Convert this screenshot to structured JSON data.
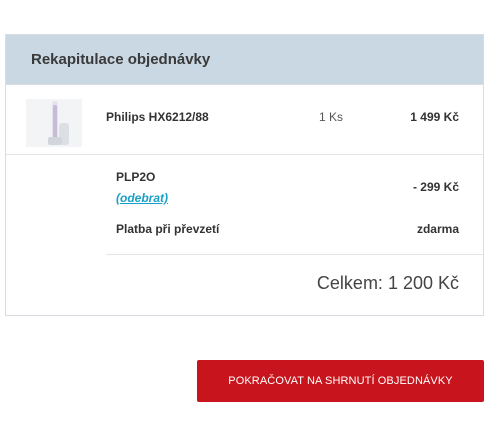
{
  "summary": {
    "title": "Rekapitulace objednávky",
    "product": {
      "name": "Philips HX6212/88",
      "quantity": "1 Ks",
      "price": "1 499 Kč",
      "thumbnail_icon": "toothbrush-icon"
    },
    "discount": {
      "code": "PLP2O",
      "remove_label": "(odebrat)",
      "value": "- 299 Kč"
    },
    "payment": {
      "label": "Platba při převzetí",
      "value": "zdarma"
    },
    "total": "Celkem: 1 200 Kč"
  },
  "actions": {
    "continue_label": "POKRAČOVAT NA SHRNUTÍ OBJEDNÁVKY"
  },
  "colors": {
    "header_bg": "#c9d8e2",
    "accent_red": "#c8151d",
    "link_blue": "#1aa0c6"
  }
}
